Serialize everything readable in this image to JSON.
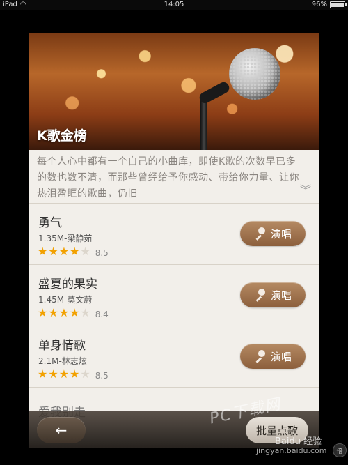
{
  "status_bar": {
    "carrier": "iPad",
    "time": "14:05",
    "battery": "96%"
  },
  "hero": {
    "title": "K歌金榜"
  },
  "description": {
    "text": "每个人心中都有一个自己的小曲库，即使K歌的次数早已多的数也数不清，而那些曾经给予你感动、带给你力量、让你热泪盈眶的歌曲，仍旧",
    "expand_icon": "double-chevron-down-icon"
  },
  "songs": [
    {
      "title": "勇气",
      "meta": "1.35M-梁静茹",
      "rating": 4,
      "score": "8.5",
      "button": "演唱"
    },
    {
      "title": "盛夏的果实",
      "meta": "1.45M-莫文蔚",
      "rating": 4,
      "score": "8.4",
      "button": "演唱"
    },
    {
      "title": "单身情歌",
      "meta": "2.1M-林志炫",
      "rating": 4,
      "score": "8.5",
      "button": "演唱"
    }
  ],
  "partial_next_song": "爱我别走",
  "bottom_bar": {
    "back_icon": "arrow-left-icon",
    "batch_label": "批量点歌"
  },
  "zoom_button": "倍",
  "watermarks": {
    "pc": "PC下载网",
    "baidu": "Baidu 经验",
    "url": "jingyan.baidu.com"
  }
}
